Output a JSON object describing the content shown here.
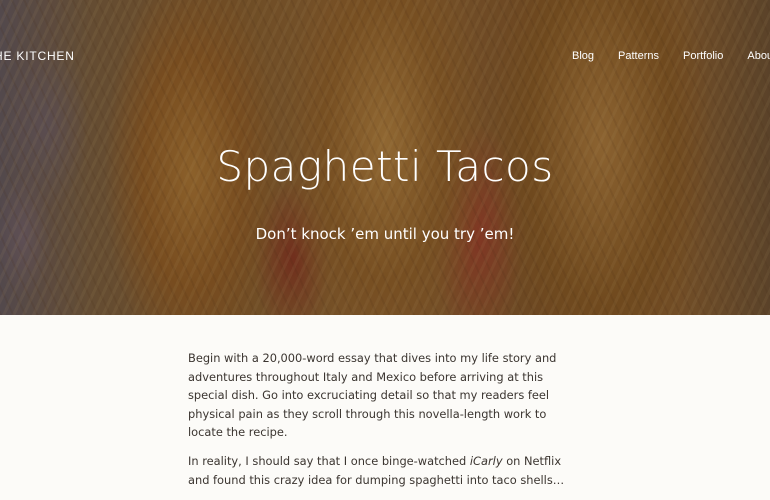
{
  "header": {
    "site_title": "HE KITCHEN",
    "nav": [
      "Blog",
      "Patterns",
      "Portfolio",
      "About"
    ]
  },
  "hero": {
    "title": "Spaghetti Tacos",
    "subtitle": "Don’t knock ’em until you try ’em!"
  },
  "article": {
    "p1": "Begin with a 20,000-word essay that dives into my life story and adventures throughout Italy and Mexico before arriving at this special dish. Go into excruciating detail so that my readers feel physical pain as they scroll through this novella-length work to locate the recipe.",
    "p2_before": "In reality, I should say that I once binge-watched ",
    "p2_em": "iCarly",
    "p2_after": " on Netflix and found this crazy idea for dumping spaghetti into taco shells…"
  },
  "colors": {
    "page_background": "#fcfbf8",
    "body_text": "#3b3530",
    "hero_text": "#ffffff"
  }
}
